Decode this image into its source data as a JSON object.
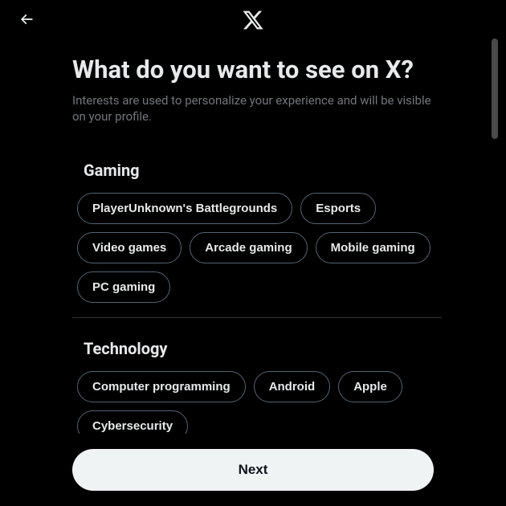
{
  "header": {
    "title": "What do you want to see on X?",
    "subtitle": "Interests are used to personalize your experience and will be visible on your profile."
  },
  "categories": [
    {
      "name": "Gaming",
      "items": [
        "PlayerUnknown's Battlegrounds",
        "Esports",
        "Video games",
        "Arcade gaming",
        "Mobile gaming",
        "PC gaming"
      ]
    },
    {
      "name": "Technology",
      "items": [
        "Computer programming",
        "Android",
        "Apple",
        "Cybersecurity"
      ]
    }
  ],
  "footer": {
    "next_label": "Next"
  }
}
